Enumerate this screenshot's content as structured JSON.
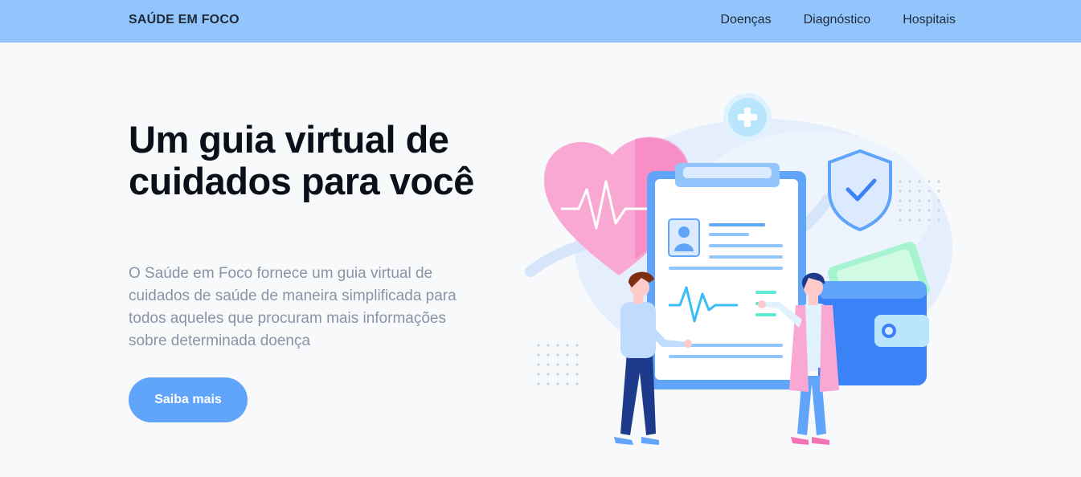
{
  "navbar": {
    "brand": "SAÚDE EM FOCO",
    "links": [
      "Doenças",
      "Diagnóstico",
      "Hospitais"
    ]
  },
  "hero": {
    "title": "Um guia virtual de cuidados para você",
    "description": "O Saúde em Foco fornece um guia virtual de cuidados de saúde de maneira simplificada para todos aqueles que procuram mais informações sobre determinada doença",
    "cta_label": "Saiba mais"
  },
  "colors": {
    "navbar_bg": "#93c5fd",
    "accent": "#60a5fa",
    "heart": "#f9a8d4",
    "page_bg": "#f8f9fb"
  },
  "icons": [
    "plus-icon",
    "heart-icon",
    "clipboard-icon",
    "shield-check-icon",
    "wallet-icon",
    "user-avatar-icon",
    "heartbeat-icon"
  ]
}
